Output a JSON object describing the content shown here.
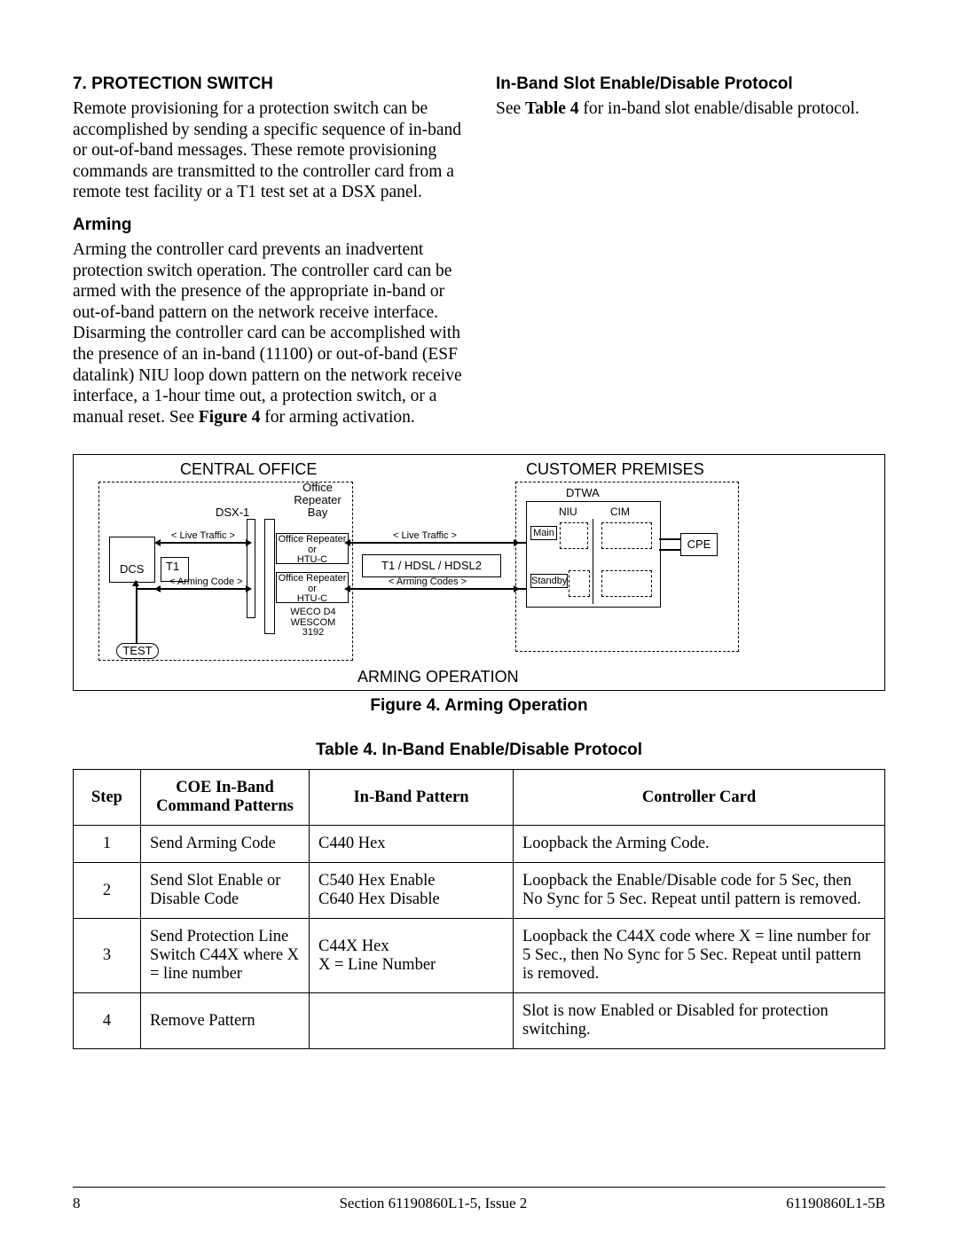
{
  "section7": {
    "heading": "7.   PROTECTION SWITCH",
    "para": "Remote provisioning for a protection switch can be accomplished by sending a specific sequence of in-band or out-of-band messages.  These remote provisioning commands are transmitted to the controller card from a remote test facility or a T1 test set at a DSX panel."
  },
  "arming": {
    "heading": "Arming",
    "para_a": "Arming the controller card prevents an inadvertent protection switch operation.  The controller card can be armed with the presence of the appropriate in-band or out-of-band pattern on the network receive interface.  Disarming the controller card can be accomplished with the presence of an in-band (11100) or out-of-band (ESF datalink) NIU loop down pattern on the network receive interface, a 1-hour time out, a protection switch, or a manual reset. See ",
    "para_fig": "Figure 4",
    "para_b": " for arming activation."
  },
  "inband": {
    "heading": "In-Band Slot Enable/Disable Protocol",
    "para_a": "See ",
    "para_tbl": "Table 4",
    "para_b": " for in-band slot enable/disable protocol."
  },
  "figure": {
    "caption": "Figure 4.  Arming Operation",
    "central_office": "CENTRAL OFFICE",
    "customer_premises": "CUSTOMER PREMISES",
    "dsx1": "DSX-1",
    "office_repeater_bay": "Office\nRepeater\nBay",
    "dcs": "DCS",
    "t1": "T1",
    "live_traffic": "< Live Traffic >",
    "arming_code": "< Arming Code >",
    "arming_codes": "< Arming Codes >",
    "office_repeater_htuc": "Office Repeater\nor\nHTU-C",
    "weco": "WECO D4\nWESCOM 3192",
    "test": "TEST",
    "t1_hdsl": "T1 / HDSL / HDSL2",
    "dtwa": "DTWA",
    "niu": "NIU",
    "cim": "CIM",
    "main": "Main",
    "standby": "Standby",
    "cpe": "CPE",
    "arming_operation": "ARMING OPERATION"
  },
  "table": {
    "caption": "Table 4.  In-Band Enable/Disable Protocol",
    "headers": {
      "step": "Step",
      "coe": "COE In-Band\nCommand Patterns",
      "pattern": "In-Band Pattern",
      "card": "Controller Card"
    },
    "rows": [
      {
        "step": "1",
        "coe": "Send Arming Code",
        "pattern": "C440 Hex",
        "card": "Loopback the Arming Code."
      },
      {
        "step": "2",
        "coe": "Send Slot Enable or Disable Code",
        "pattern": "C540 Hex Enable\nC640 Hex Disable",
        "card": "Loopback the Enable/Disable code for 5 Sec, then No Sync for 5 Sec. Repeat until pattern is removed."
      },
      {
        "step": "3",
        "coe": "Send Protection Line Switch C44X where X = line number",
        "pattern": "C44X Hex\nX = Line Number",
        "card": "Loopback the C44X code where X = line number for 5 Sec., then No Sync for 5 Sec. Repeat until pattern is removed."
      },
      {
        "step": "4",
        "coe": "Remove Pattern",
        "pattern": "",
        "card": "Slot is now Enabled or Disabled for protection switching."
      }
    ]
  },
  "footer": {
    "page": "8",
    "center": "Section 61190860L1-5, Issue 2",
    "right": "61190860L1-5B"
  }
}
